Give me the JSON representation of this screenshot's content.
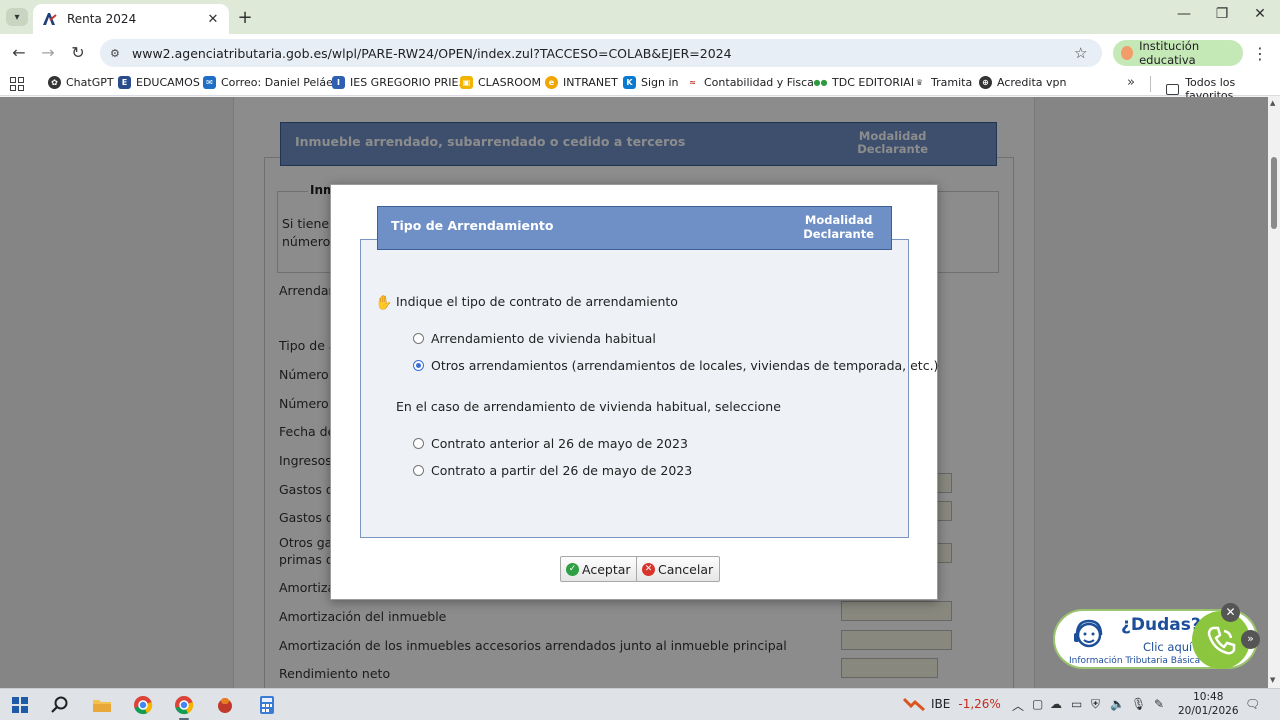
{
  "browser": {
    "tab": {
      "title": "Renta 2024"
    },
    "url": "www2.agenciatributaria.gob.es/wlpl/PARE-RW24/OPEN/index.zul?TACCESO=COLAB&EJER=2024",
    "profile_label": "Institución educativa",
    "bookmarks": [
      "ChatGPT",
      "EDUCAMOS",
      "Correo: Daniel Peláe...",
      "IES GREGORIO PRIE...",
      "CLASROOM",
      "INTRANET",
      "Sign in",
      "Contabilidad y Fisca...",
      "TDC EDITORIAL",
      "Tramita",
      "Acredita vpn"
    ],
    "all_bookmarks_label": "Todos los favoritos"
  },
  "background_form": {
    "header_title": "Inmueble arrendado, subarrendado o cedido a terceros",
    "header_right_line1": "Modalidad",
    "header_right_line2": "Declarante",
    "legend": "Inm",
    "fieldset_text_1": "Si tiene i",
    "fieldset_text_2": "número",
    "rows": [
      "Arrendam",
      "Tipo de a",
      "Número t",
      "Número d",
      "Fecha del",
      "Ingresos í",
      "Gastos de",
      "Gastos de",
      "Otros gas",
      "primas de",
      "Amortiza",
      "Amortización del inmueble",
      "Amortización de los inmuebles accesorios arrendados junto al inmueble principal",
      "Rendimiento neto"
    ]
  },
  "modal": {
    "header_title": "Tipo de Arrendamiento",
    "header_right_line1": "Modalidad",
    "header_right_line2": "Declarante",
    "question_1": "Indique el tipo de contrato de arrendamiento",
    "options_1": [
      {
        "label": "Arrendamiento de vivienda habitual",
        "checked": false
      },
      {
        "label": "Otros arrendamientos (arrendamientos de locales, viviendas de temporada, etc.)",
        "checked": true
      }
    ],
    "question_2": "En el caso de arrendamiento de vivienda habitual, seleccione",
    "options_2": [
      {
        "label": "Contrato anterior al 26 de mayo de 2023",
        "checked": false
      },
      {
        "label": "Contrato a partir del 26 de mayo de 2023",
        "checked": false
      }
    ],
    "accept_label": "Aceptar",
    "cancel_label": "Cancelar"
  },
  "help_widget": {
    "title": "¿Dudas?",
    "subtitle": "Clic aquí",
    "small": "Información Tributaria Básica"
  },
  "taskbar": {
    "stock_symbol": "IBE",
    "stock_change": "-1,26%",
    "time": "10:48",
    "date": "20/01/2026"
  },
  "colors": {
    "header_blue": "#6f90c6",
    "radio_blue": "#3b6fd6",
    "help_green": "#8cc63f",
    "stock_red": "#c42b1c"
  }
}
